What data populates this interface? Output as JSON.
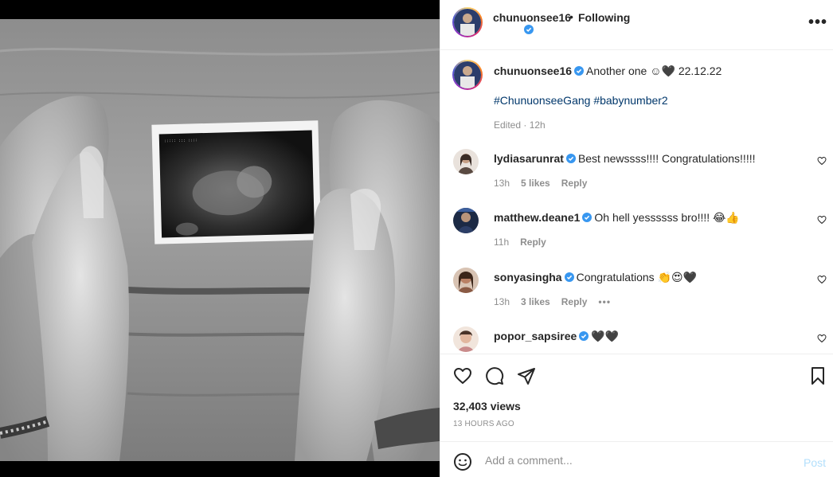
{
  "post": {
    "author": "chunuonsee16",
    "follow_status": "Following",
    "separator": "•",
    "more_label": "•••",
    "caption_text": "Another one ☺🖤 22.12.22",
    "hashtags": "#ChunuonseeGang #babynumber2",
    "edited": "Edited · 12h"
  },
  "comments": [
    {
      "username": "lydiasarunrat",
      "text": "Best newssss!!!! Congratulations!!!!!",
      "time": "13h",
      "likes": "5 likes",
      "reply": "Reply",
      "avatar_color": "#5a4a42"
    },
    {
      "username": "matthew.deane1",
      "text": "Oh hell yessssss bro!!!! 😂👍",
      "time": "11h",
      "likes": "",
      "reply": "Reply",
      "avatar_color": "#1f2d4a"
    },
    {
      "username": "sonyasingha",
      "text": "Congratulations 👏😍🖤",
      "time": "13h",
      "likes": "3 likes",
      "reply": "Reply",
      "options": "•••",
      "avatar_color": "#8a5a44"
    },
    {
      "username": "popor_sapsiree",
      "text": "🖤🖤",
      "avatar_color": "#c98b8b"
    }
  ],
  "stats": {
    "views": "32,403 views",
    "time_ago": "13 HOURS AGO"
  },
  "add_comment": {
    "placeholder": "Add a comment...",
    "post_label": "Post"
  },
  "colors": {
    "verified": "#3897f0",
    "link": "#00376b",
    "muted": "#8e8e8e",
    "post_disabled": "#b2dffc"
  },
  "icons": [
    "verified-badge-icon",
    "heart-icon",
    "comment-icon",
    "share-icon",
    "bookmark-icon",
    "emoji-icon",
    "more-icon"
  ]
}
